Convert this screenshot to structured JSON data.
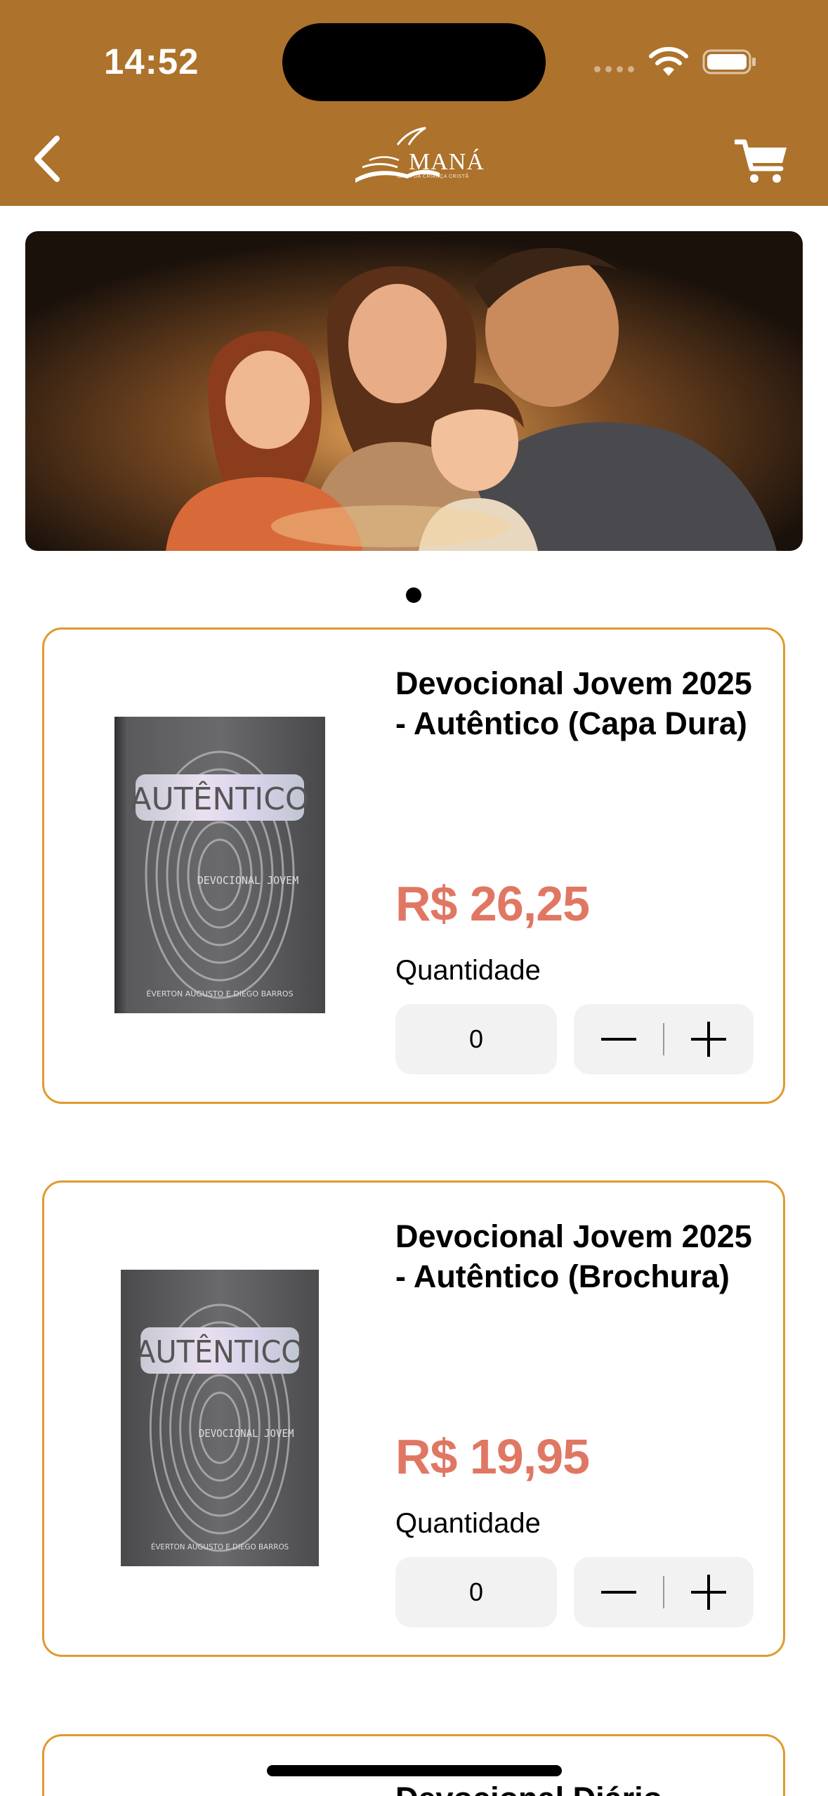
{
  "status_bar": {
    "time": "14:52"
  },
  "header": {
    "logo_text": "MANÁ",
    "logo_tagline": "CASA DA CRIANÇA CRISTÃ",
    "bg_color": "#ad722b"
  },
  "carousel": {
    "pages": 1,
    "active_index": 0
  },
  "products": [
    {
      "title": "Devocional Jovem 2025 - Autêntico (Capa Dura)",
      "price": "R$ 26,25",
      "quantity_label": "Quantidade",
      "quantity": "0",
      "cover": {
        "title": "AUTÊNTICO",
        "subtitle": "DEVOCIONAL JOVEM",
        "authors": "ÉVERTON AUGUSTO E DIEGO BARROS"
      }
    },
    {
      "title": "Devocional Jovem 2025 - Autêntico (Brochura)",
      "price": "R$ 19,95",
      "quantity_label": "Quantidade",
      "quantity": "0",
      "cover": {
        "title": "AUTÊNTICO",
        "subtitle": "DEVOCIONAL JOVEM",
        "authors": "ÉVERTON AUGUSTO E DIEGO BARROS"
      }
    },
    {
      "title": "Devocional Diário"
    }
  ],
  "colors": {
    "accent": "#e09a2e",
    "price": "#e07763",
    "field_bg": "#f2f2f2"
  }
}
